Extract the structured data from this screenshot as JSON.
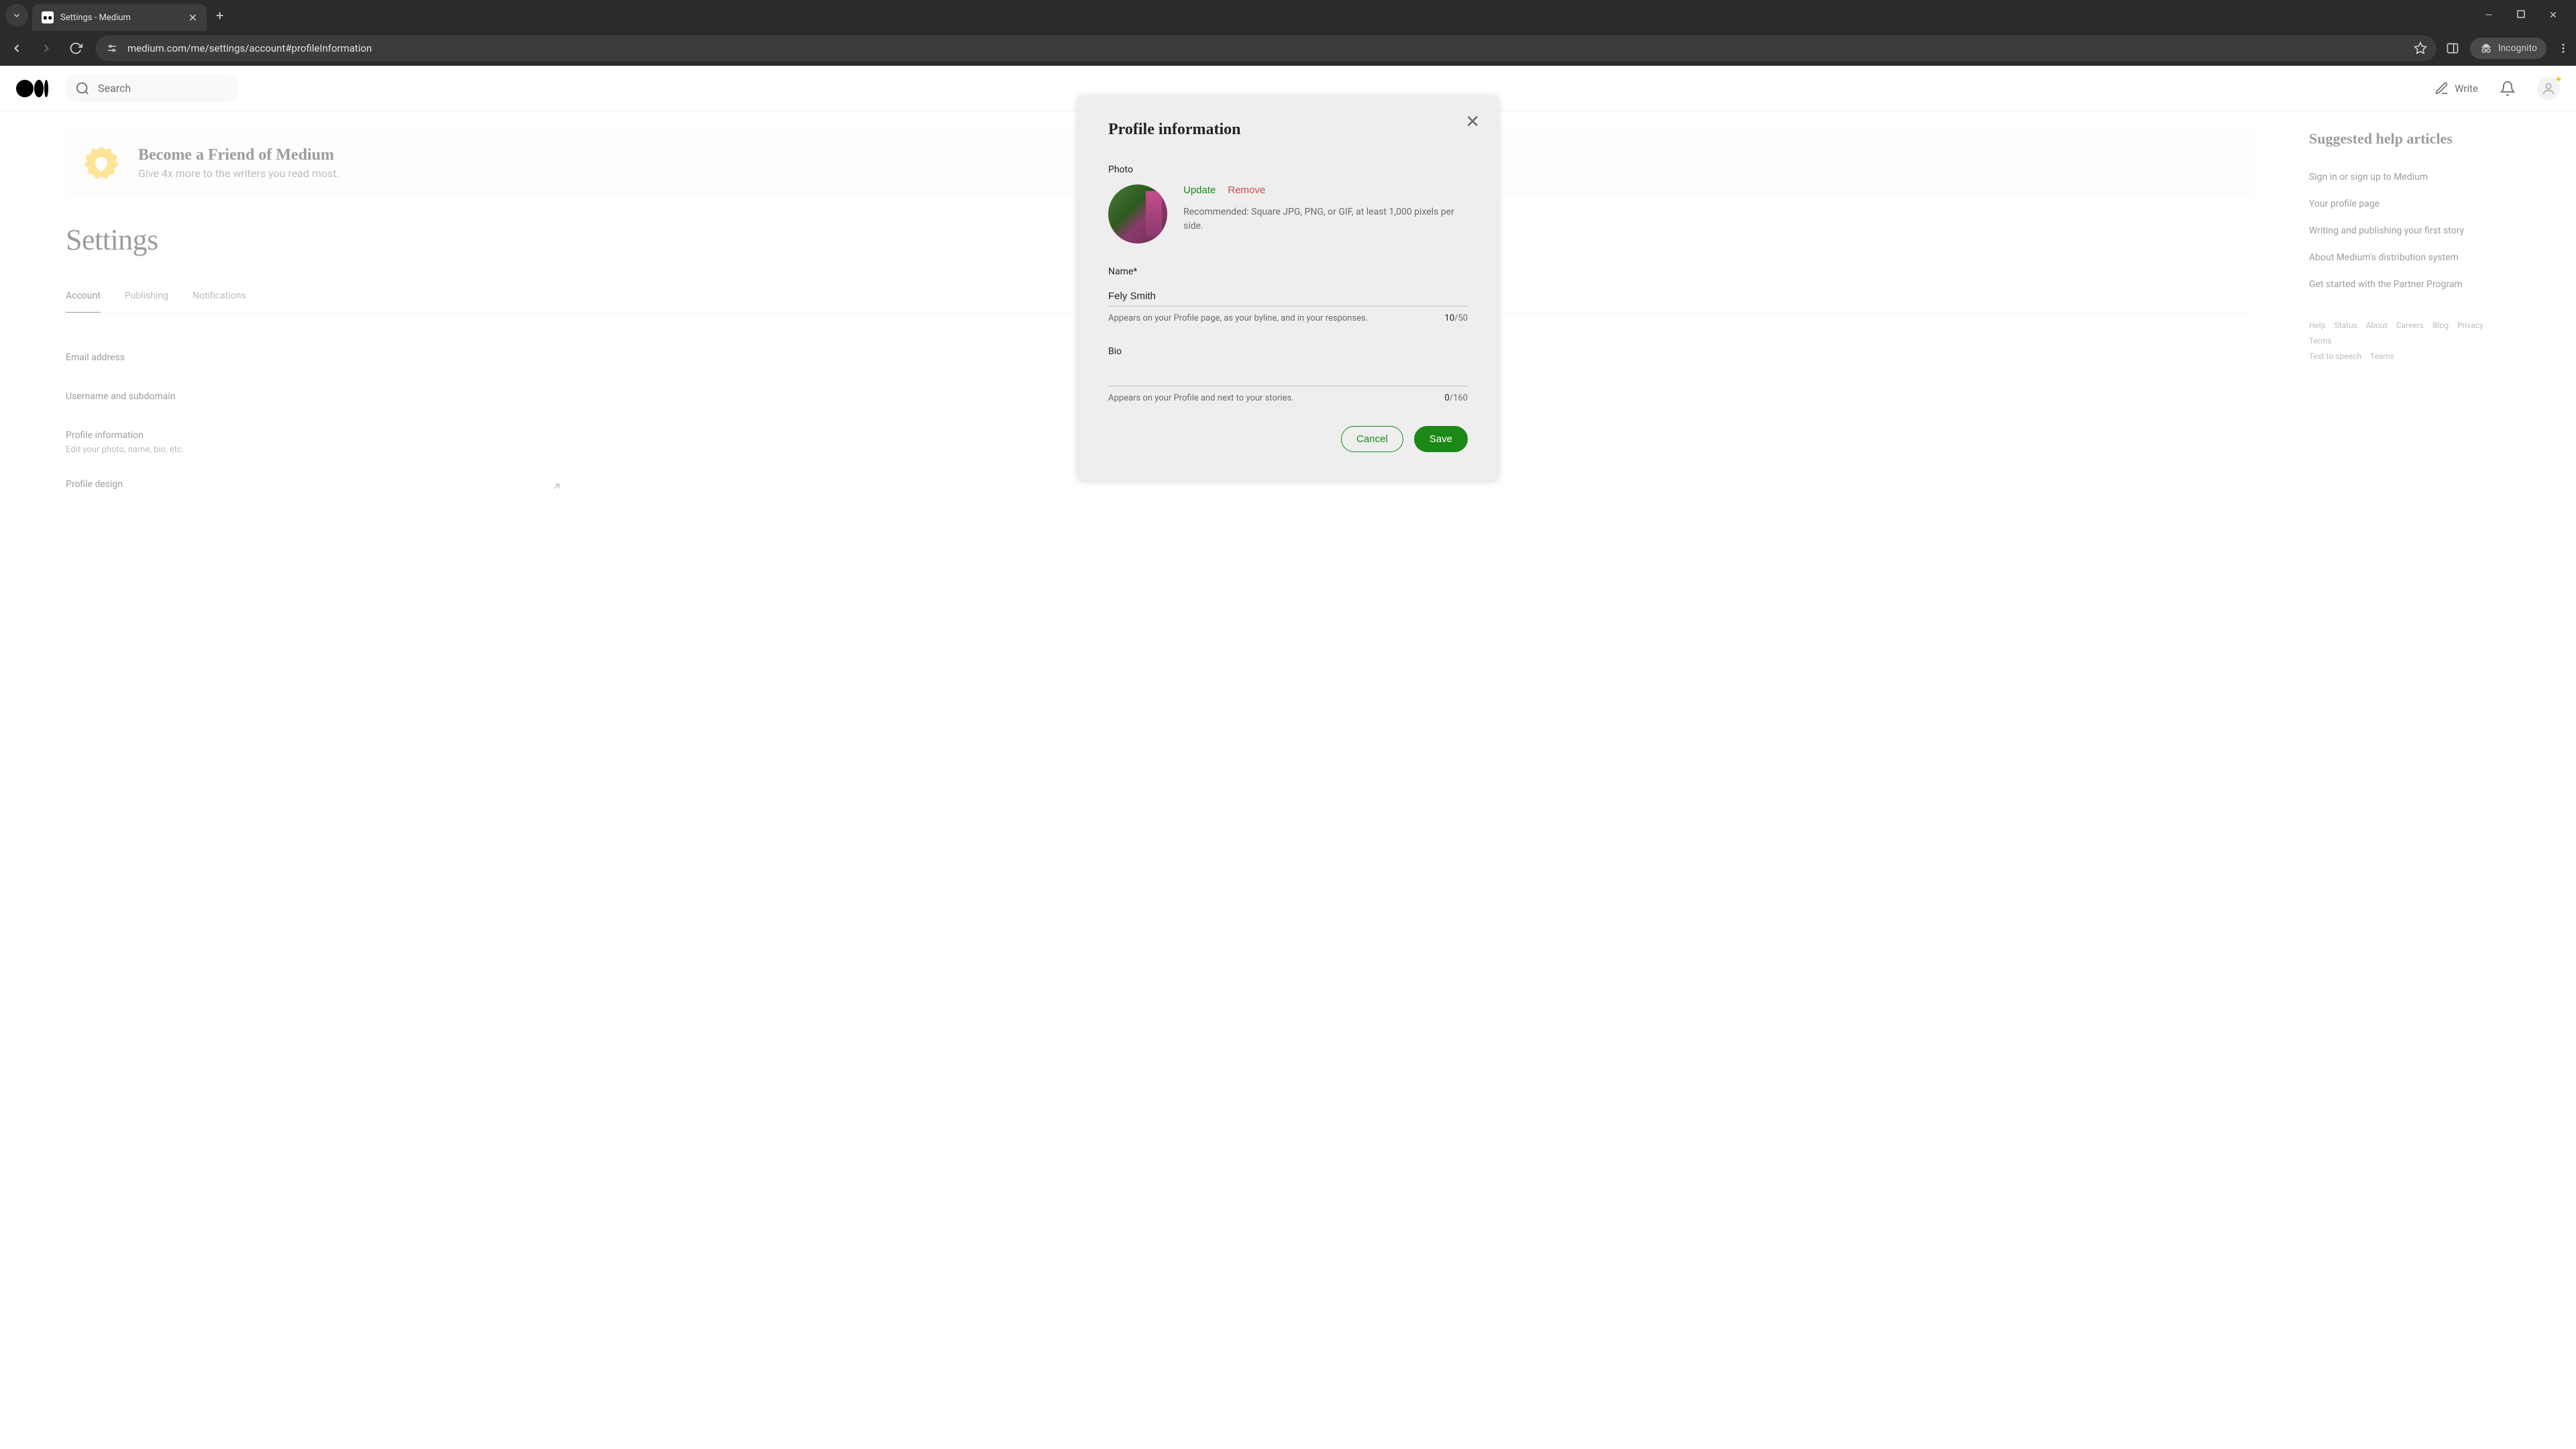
{
  "browser": {
    "tab_title": "Settings - Medium",
    "url": "medium.com/me/settings/account#profileInformation",
    "incognito_label": "Incognito"
  },
  "header": {
    "search_placeholder": "Search",
    "write_label": "Write"
  },
  "promo": {
    "title": "Become a Friend of Medium",
    "subtitle": "Give 4x more to the writers you read most."
  },
  "page": {
    "title": "Settings",
    "tabs": [
      "Account",
      "Publishing",
      "Notifications"
    ],
    "active_tab": "Account"
  },
  "settings_rows": {
    "email": {
      "label": "Email address"
    },
    "username": {
      "label": "Username and subdomain"
    },
    "profile_info": {
      "label": "Profile information",
      "sub": "Edit your photo, name, bio, etc."
    },
    "profile_design": {
      "label": "Profile design"
    }
  },
  "sidebar": {
    "title": "Suggested help articles",
    "items": [
      "Sign in or sign up to Medium",
      "Your profile page",
      "Writing and publishing your first story",
      "About Medium's distribution system",
      "Get started with the Partner Program"
    ],
    "footer": [
      "Help",
      "Status",
      "About",
      "Careers",
      "Blog",
      "Privacy",
      "Terms",
      "Text to speech",
      "Teams"
    ]
  },
  "modal": {
    "title": "Profile information",
    "photo": {
      "label": "Photo",
      "update": "Update",
      "remove": "Remove",
      "hint": "Recommended: Square JPG, PNG, or GIF, at least 1,000 pixels per side."
    },
    "name": {
      "label": "Name*",
      "value": "Fely Smith",
      "hint": "Appears on your Profile page, as your byline, and in your responses.",
      "count": "10",
      "max": "/50"
    },
    "bio": {
      "label": "Bio",
      "value": "",
      "hint": "Appears on your Profile and next to your stories.",
      "count": "0",
      "max": "/160"
    },
    "cancel": "Cancel",
    "save": "Save"
  }
}
